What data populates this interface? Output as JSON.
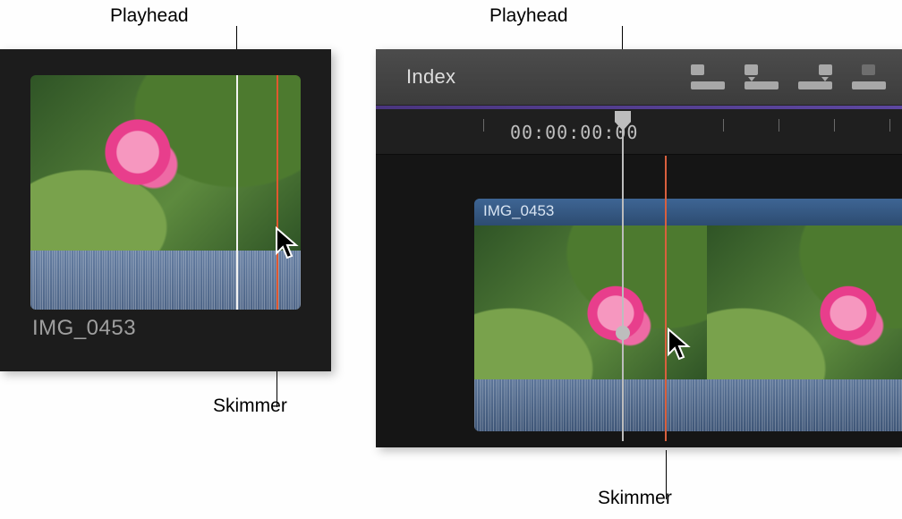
{
  "callouts": {
    "left_playhead": "Playhead",
    "left_skimmer": "Skimmer",
    "right_playhead": "Playhead",
    "right_skimmer": "Skimmer"
  },
  "browser": {
    "clip_name": "IMG_0453"
  },
  "timeline": {
    "index_button": "Index",
    "timecode": "00:00:00:00",
    "clip_name": "IMG_0453"
  }
}
